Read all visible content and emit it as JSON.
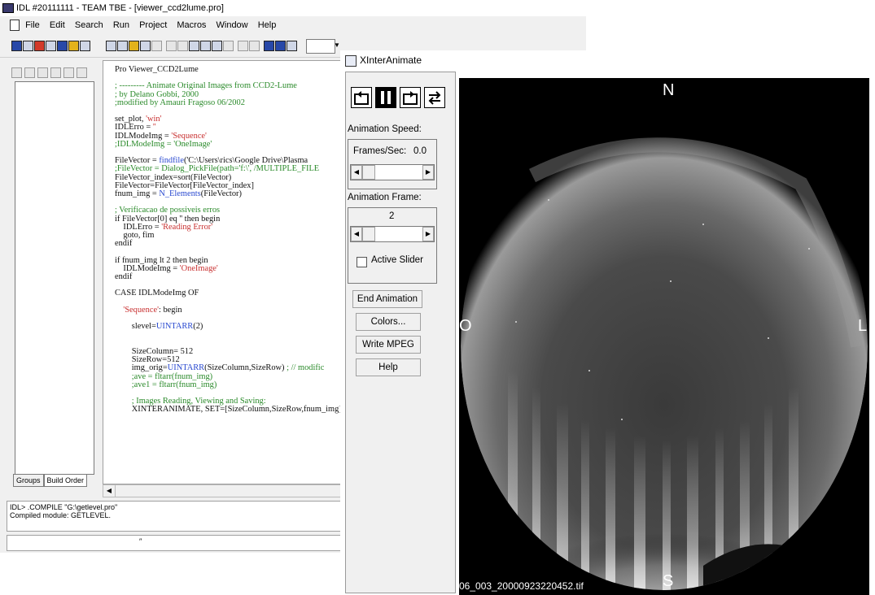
{
  "idl": {
    "title": "IDL #20111111 - TEAM TBE - [viewer_ccd2lume.pro]",
    "menu": [
      "File",
      "Edit",
      "Search",
      "Run",
      "Project",
      "Macros",
      "Window",
      "Help"
    ],
    "side_tabs": [
      "Groups",
      "Build Order"
    ],
    "console": {
      "line1": "IDL> .COMPILE \"G:\\getlevel.pro\"",
      "line2": "Compiled module: GETLEVEL."
    }
  },
  "code_lines": [
    {
      "text": "Pro Viewer_CCD2Lume",
      "cls": "kw"
    },
    {
      "text": "",
      "cls": ""
    },
    {
      "text": "; --------- Animate Original Images from CCD2-Lume",
      "cls": "cm"
    },
    {
      "text": "; by Delano Gobbi, 2000",
      "cls": "cm"
    },
    {
      "text": ";modified by Amauri Fragoso 06/2002",
      "cls": "cm"
    },
    {
      "text": "",
      "cls": ""
    },
    {
      "text": "set_plot, 'win'",
      "cls": "mix1"
    },
    {
      "text": "IDLErro = ''",
      "cls": "mix2"
    },
    {
      "text": "IDLModeImg = 'Sequence'",
      "cls": "mix3"
    },
    {
      "text": ";IDLModeImg = 'OneImage'",
      "cls": "cm"
    },
    {
      "text": "",
      "cls": ""
    },
    {
      "text": "FileVector = findfile('C:\\Users\\rics\\Google Drive\\Plasma",
      "cls": "mix4"
    },
    {
      "text": ";FileVector = Dialog_PickFile(path='f:\\', /MULTIPLE_FILE",
      "cls": "cm"
    },
    {
      "text": "FileVector_index=sort(FileVector)",
      "cls": "kw"
    },
    {
      "text": "FileVector=FileVector[FileVector_index]",
      "cls": "kw"
    },
    {
      "text": "fnum_img = N_Elements(FileVector)",
      "cls": "mix5"
    },
    {
      "text": "",
      "cls": ""
    },
    {
      "text": "; Verificacao de possiveis erros",
      "cls": "cm"
    },
    {
      "text": "if FileVector[0] eq '' then begin",
      "cls": "kw"
    },
    {
      "text": "    IDLErro = 'Reading Error'",
      "cls": "mix6"
    },
    {
      "text": "    goto, fim",
      "cls": "kw"
    },
    {
      "text": "endif",
      "cls": "kw"
    },
    {
      "text": "",
      "cls": ""
    },
    {
      "text": "if fnum_img lt 2 then begin",
      "cls": "kw"
    },
    {
      "text": "    IDLModeImg = 'OneImage'",
      "cls": "mix7"
    },
    {
      "text": "endif",
      "cls": "kw"
    },
    {
      "text": "",
      "cls": ""
    },
    {
      "text": "CASE IDLModeImg OF",
      "cls": "kw"
    },
    {
      "text": "",
      "cls": ""
    },
    {
      "text": "    'Sequence': begin",
      "cls": "mix8"
    },
    {
      "text": "",
      "cls": ""
    },
    {
      "text": "        slevel=UINTARR(2)",
      "cls": "mix9"
    },
    {
      "text": "",
      "cls": ""
    },
    {
      "text": "",
      "cls": ""
    },
    {
      "text": "        SizeColumn= 512",
      "cls": "kw"
    },
    {
      "text": "        SizeRow=512",
      "cls": "kw"
    },
    {
      "text": "        img_orig=UINTARR(SizeColumn,SizeRow) ; // modific",
      "cls": "mix10"
    },
    {
      "text": "        ;ave = fltarr(fnum_img)",
      "cls": "cm"
    },
    {
      "text": "        ;ave1 = fltarr(fnum_img)",
      "cls": "cm"
    },
    {
      "text": "",
      "cls": ""
    },
    {
      "text": "        ; Images Reading, Viewing and Saving:",
      "cls": "cm"
    },
    {
      "text": "        XINTERANIMATE, SET=[SizeColumn,SizeRow,fnum_img],",
      "cls": "kw"
    }
  ],
  "xia": {
    "title": "XInterAnimate",
    "anim_speed_label": "Animation Speed:",
    "frames_per_sec_label": "Frames/Sec:",
    "frames_per_sec_value": "0.0",
    "anim_frame_label": "Animation Frame:",
    "frame_value": "2",
    "active_slider_label": "Active Slider",
    "active_slider_checked": false,
    "buttons": {
      "end": "End Animation",
      "colors": "Colors...",
      "mpeg": "Write MPEG",
      "help": "Help"
    },
    "image": {
      "north": "N",
      "south": "S",
      "west": "O",
      "east": "L",
      "filename": "06_003_20000923220452.tif"
    }
  }
}
